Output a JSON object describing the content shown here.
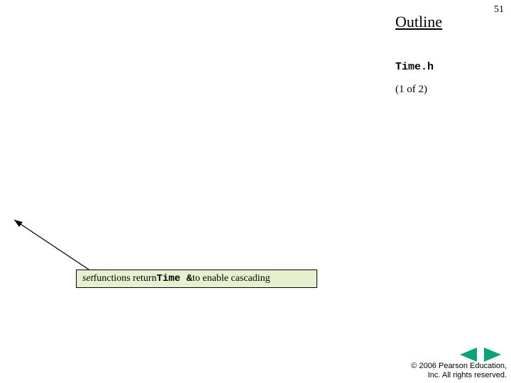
{
  "page_number": "51",
  "outline": {
    "title": "Outline",
    "filename": "Time.h",
    "page_indicator": "(1 of 2)"
  },
  "callout": {
    "prefix_italic": "set",
    "mid": " functions return ",
    "code": "Time &",
    "suffix": " to enable cascading"
  },
  "footer": {
    "copyright_line1": "© 2006 Pearson Education,",
    "copyright_line2": "Inc.  All rights reserved."
  },
  "nav": {
    "prev_color": "#0aa37a",
    "next_color": "#0aa37a"
  }
}
